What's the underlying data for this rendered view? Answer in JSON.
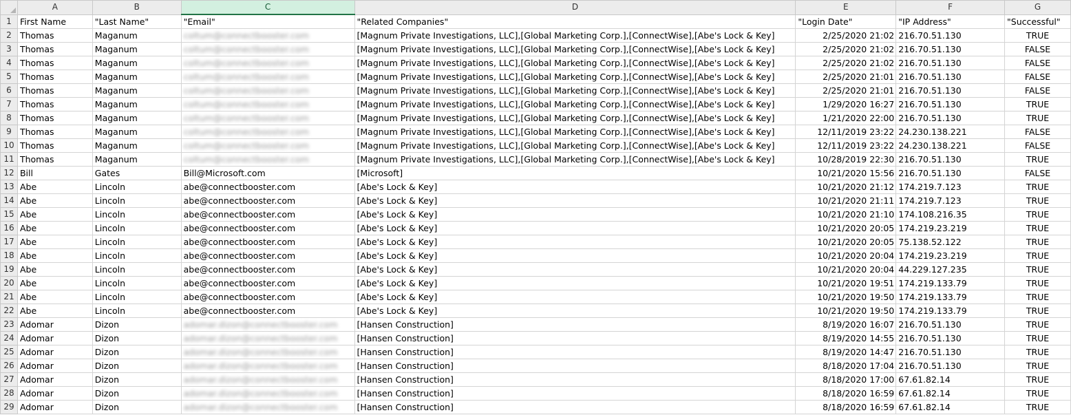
{
  "columns": [
    "A",
    "B",
    "C",
    "D",
    "E",
    "F",
    "G"
  ],
  "selected_column": "C",
  "header_row": {
    "row_num": "1",
    "first": "First Name",
    "last": "\"Last Name\"",
    "email": "\"Email\"",
    "companies": "\"Related Companies\"",
    "login": "\"Login Date\"",
    "ip": "\"IP Address\"",
    "success": "\"Successful\""
  },
  "rows": [
    {
      "n": "2",
      "first": "Thomas",
      "last": "Maganum",
      "email": "coltum@connectbooster.com",
      "companies": "[Magnum Private Investigations, LLC],[Global Marketing Corp.],[ConnectWise],[Abe's Lock & Key]",
      "login": "2/25/2020 21:02",
      "ip": "216.70.51.130",
      "success": "TRUE"
    },
    {
      "n": "3",
      "first": "Thomas",
      "last": "Maganum",
      "email": "coltum@connectbooster.com",
      "companies": "[Magnum Private Investigations, LLC],[Global Marketing Corp.],[ConnectWise],[Abe's Lock & Key]",
      "login": "2/25/2020 21:02",
      "ip": "216.70.51.130",
      "success": "FALSE"
    },
    {
      "n": "4",
      "first": "Thomas",
      "last": "Maganum",
      "email": "coltum@connectbooster.com",
      "companies": "[Magnum Private Investigations, LLC],[Global Marketing Corp.],[ConnectWise],[Abe's Lock & Key]",
      "login": "2/25/2020 21:02",
      "ip": "216.70.51.130",
      "success": "FALSE"
    },
    {
      "n": "5",
      "first": "Thomas",
      "last": "Maganum",
      "email": "coltum@connectbooster.com",
      "companies": "[Magnum Private Investigations, LLC],[Global Marketing Corp.],[ConnectWise],[Abe's Lock & Key]",
      "login": "2/25/2020 21:01",
      "ip": "216.70.51.130",
      "success": "FALSE"
    },
    {
      "n": "6",
      "first": "Thomas",
      "last": "Maganum",
      "email": "coltum@connectbooster.com",
      "companies": "[Magnum Private Investigations, LLC],[Global Marketing Corp.],[ConnectWise],[Abe's Lock & Key]",
      "login": "2/25/2020 21:01",
      "ip": "216.70.51.130",
      "success": "FALSE"
    },
    {
      "n": "7",
      "first": "Thomas",
      "last": "Maganum",
      "email": "coltum@connectbooster.com",
      "companies": "[Magnum Private Investigations, LLC],[Global Marketing Corp.],[ConnectWise],[Abe's Lock & Key]",
      "login": "1/29/2020 16:27",
      "ip": "216.70.51.130",
      "success": "TRUE"
    },
    {
      "n": "8",
      "first": "Thomas",
      "last": "Maganum",
      "email": "coltum@connectbooster.com",
      "companies": "[Magnum Private Investigations, LLC],[Global Marketing Corp.],[ConnectWise],[Abe's Lock & Key]",
      "login": "1/21/2020 22:00",
      "ip": "216.70.51.130",
      "success": "TRUE"
    },
    {
      "n": "9",
      "first": "Thomas",
      "last": "Maganum",
      "email": "coltum@connectbooster.com",
      "companies": "[Magnum Private Investigations, LLC],[Global Marketing Corp.],[ConnectWise],[Abe's Lock & Key]",
      "login": "12/11/2019 23:22",
      "ip": "24.230.138.221",
      "success": "FALSE"
    },
    {
      "n": "10",
      "first": "Thomas",
      "last": "Maganum",
      "email": "coltum@connectbooster.com",
      "companies": "[Magnum Private Investigations, LLC],[Global Marketing Corp.],[ConnectWise],[Abe's Lock & Key]",
      "login": "12/11/2019 23:22",
      "ip": "24.230.138.221",
      "success": "FALSE"
    },
    {
      "n": "11",
      "first": "Thomas",
      "last": "Maganum",
      "email": "coltum@connectbooster.com",
      "companies": "[Magnum Private Investigations, LLC],[Global Marketing Corp.],[ConnectWise],[Abe's Lock & Key]",
      "login": "10/28/2019 22:30",
      "ip": "216.70.51.130",
      "success": "TRUE"
    },
    {
      "n": "12",
      "first": "Bill",
      "last": "Gates",
      "email": "Bill@Microsoft.com",
      "companies": "[Microsoft]",
      "login": "10/21/2020 15:56",
      "ip": "216.70.51.130",
      "success": "FALSE"
    },
    {
      "n": "13",
      "first": "Abe",
      "last": "Lincoln",
      "email": "abe@connectbooster.com",
      "companies": "[Abe's Lock & Key]",
      "login": "10/21/2020 21:12",
      "ip": "174.219.7.123",
      "success": "TRUE"
    },
    {
      "n": "14",
      "first": "Abe",
      "last": "Lincoln",
      "email": "abe@connectbooster.com",
      "companies": "[Abe's Lock & Key]",
      "login": "10/21/2020 21:11",
      "ip": "174.219.7.123",
      "success": "TRUE"
    },
    {
      "n": "15",
      "first": "Abe",
      "last": "Lincoln",
      "email": "abe@connectbooster.com",
      "companies": "[Abe's Lock & Key]",
      "login": "10/21/2020 21:10",
      "ip": "174.108.216.35",
      "success": "TRUE"
    },
    {
      "n": "16",
      "first": "Abe",
      "last": "Lincoln",
      "email": "abe@connectbooster.com",
      "companies": "[Abe's Lock & Key]",
      "login": "10/21/2020 20:05",
      "ip": "174.219.23.219",
      "success": "TRUE"
    },
    {
      "n": "17",
      "first": "Abe",
      "last": "Lincoln",
      "email": "abe@connectbooster.com",
      "companies": "[Abe's Lock & Key]",
      "login": "10/21/2020 20:05",
      "ip": "75.138.52.122",
      "success": "TRUE"
    },
    {
      "n": "18",
      "first": "Abe",
      "last": "Lincoln",
      "email": "abe@connectbooster.com",
      "companies": "[Abe's Lock & Key]",
      "login": "10/21/2020 20:04",
      "ip": "174.219.23.219",
      "success": "TRUE"
    },
    {
      "n": "19",
      "first": "Abe",
      "last": "Lincoln",
      "email": "abe@connectbooster.com",
      "companies": "[Abe's Lock & Key]",
      "login": "10/21/2020 20:04",
      "ip": "44.229.127.235",
      "success": "TRUE"
    },
    {
      "n": "20",
      "first": "Abe",
      "last": "Lincoln",
      "email": "abe@connectbooster.com",
      "companies": "[Abe's Lock & Key]",
      "login": "10/21/2020 19:51",
      "ip": "174.219.133.79",
      "success": "TRUE"
    },
    {
      "n": "21",
      "first": "Abe",
      "last": "Lincoln",
      "email": "abe@connectbooster.com",
      "companies": "[Abe's Lock & Key]",
      "login": "10/21/2020 19:50",
      "ip": "174.219.133.79",
      "success": "TRUE"
    },
    {
      "n": "22",
      "first": "Abe",
      "last": "Lincoln",
      "email": "abe@connectbooster.com",
      "companies": "[Abe's Lock & Key]",
      "login": "10/21/2020 19:50",
      "ip": "174.219.133.79",
      "success": "TRUE"
    },
    {
      "n": "23",
      "first": "Adomar",
      "last": "Dizon",
      "email": "adomar.dizon@connectbooster.com",
      "companies": "[Hansen Construction]",
      "login": "8/19/2020 16:07",
      "ip": "216.70.51.130",
      "success": "TRUE"
    },
    {
      "n": "24",
      "first": "Adomar",
      "last": "Dizon",
      "email": "adomar.dizon@connectbooster.com",
      "companies": "[Hansen Construction]",
      "login": "8/19/2020 14:55",
      "ip": "216.70.51.130",
      "success": "TRUE"
    },
    {
      "n": "25",
      "first": "Adomar",
      "last": "Dizon",
      "email": "adomar.dizon@connectbooster.com",
      "companies": "[Hansen Construction]",
      "login": "8/19/2020 14:47",
      "ip": "216.70.51.130",
      "success": "TRUE"
    },
    {
      "n": "26",
      "first": "Adomar",
      "last": "Dizon",
      "email": "adomar.dizon@connectbooster.com",
      "companies": "[Hansen Construction]",
      "login": "8/18/2020 17:04",
      "ip": "216.70.51.130",
      "success": "TRUE"
    },
    {
      "n": "27",
      "first": "Adomar",
      "last": "Dizon",
      "email": "adomar.dizon@connectbooster.com",
      "companies": "[Hansen Construction]",
      "login": "8/18/2020 17:00",
      "ip": "67.61.82.14",
      "success": "TRUE"
    },
    {
      "n": "28",
      "first": "Adomar",
      "last": "Dizon",
      "email": "adomar.dizon@connectbooster.com",
      "companies": "[Hansen Construction]",
      "login": "8/18/2020 16:59",
      "ip": "67.61.82.14",
      "success": "TRUE"
    },
    {
      "n": "29",
      "first": "Adomar",
      "last": "Dizon",
      "email": "adomar.dizon@connectbooster.com",
      "companies": "[Hansen Construction]",
      "login": "8/18/2020 16:59",
      "ip": "67.61.82.14",
      "success": "TRUE"
    }
  ],
  "blurred_email_rows": [
    "2",
    "3",
    "4",
    "5",
    "6",
    "7",
    "8",
    "9",
    "10",
    "11",
    "23",
    "24",
    "25",
    "26",
    "27",
    "28",
    "29"
  ],
  "colors": {
    "selected_header": "#d3f0e0",
    "accent": "#217346",
    "grid": "#d4d4d4",
    "header_bg": "#ececec"
  }
}
